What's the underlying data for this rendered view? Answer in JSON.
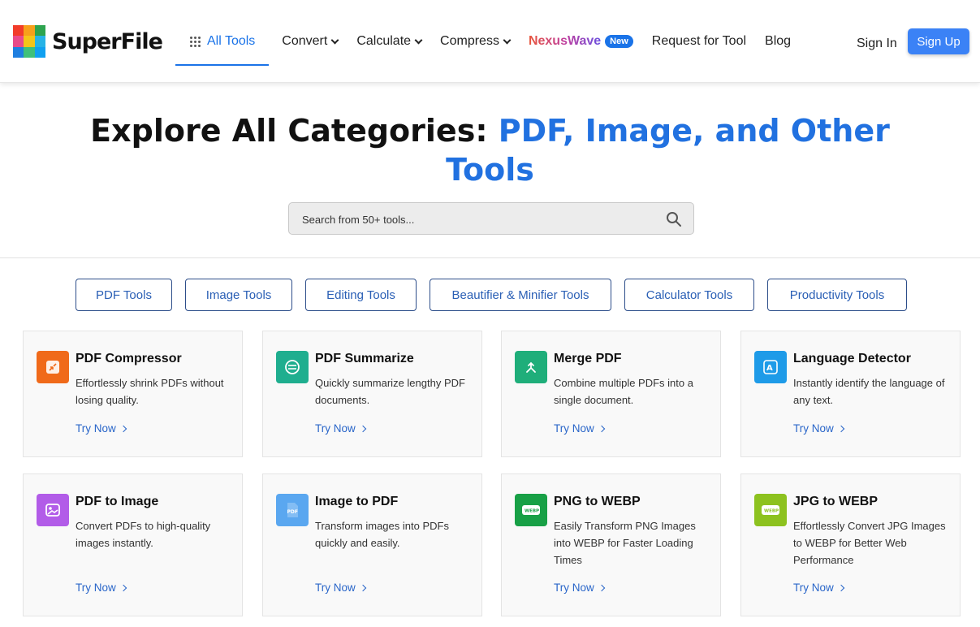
{
  "brand": {
    "name": "SuperFile",
    "logo_colors": [
      "#f23c2a",
      "#f7a01b",
      "#2ea44f",
      "#e94b8a",
      "#f5c518",
      "#27b3e6",
      "#1f7fe0",
      "#3fc07a",
      "#10a0f0"
    ]
  },
  "nav": {
    "all_tools": "All Tools",
    "convert": "Convert",
    "calculate": "Calculate",
    "compress": "Compress",
    "nexuswave": "NexusWave",
    "new_badge": "New",
    "request": "Request for Tool",
    "blog": "Blog",
    "sign_in": "Sign In",
    "sign_up": "Sign Up"
  },
  "hero": {
    "title_plain": "Explore All Categories: ",
    "title_highlight_1": "PDF, Image, and Other",
    "title_highlight_2": "Tools",
    "search_placeholder": "Search from 50+ tools..."
  },
  "categories": [
    "PDF Tools",
    "Image Tools",
    "Editing Tools",
    "Beautifier & Minifier Tools",
    "Calculator Tools",
    "Productivity Tools"
  ],
  "cards": [
    {
      "title": "PDF Compressor",
      "desc": "Effortlessly shrink PDFs without losing quality.",
      "try": "Try Now",
      "icon": "compress-icon",
      "color": "#f06a1a"
    },
    {
      "title": "PDF Summarize",
      "desc": "Quickly summarize lengthy PDF documents.",
      "try": "Try Now",
      "icon": "summarize-icon",
      "color": "#1fae8f"
    },
    {
      "title": "Merge PDF",
      "desc": "Combine multiple PDFs into a single document.",
      "try": "Try Now",
      "icon": "merge-icon",
      "color": "#1fae7a"
    },
    {
      "title": "Language Detector",
      "desc": "Instantly identify the language of any text.",
      "try": "Try Now",
      "icon": "translate-icon",
      "color": "#1e9be8"
    },
    {
      "title": "PDF to Image",
      "desc": "Convert PDFs to high-quality images instantly.",
      "try": "Try Now",
      "icon": "image-icon",
      "color": "#b25ce8"
    },
    {
      "title": "Image to PDF",
      "desc": "Transform images into PDFs quickly and easily.",
      "try": "Try Now",
      "icon": "pdf-file-icon",
      "color": "#5aa7f0"
    },
    {
      "title": "PNG to WEBP",
      "desc": "Easily Transform PNG Images into WEBP for Faster Loading Times",
      "try": "Try Now",
      "icon": "webp-icon",
      "color": "#18a046"
    },
    {
      "title": "JPG to WEBP",
      "desc": "Effortlessly Convert JPG Images to WEBP for Better Web Performance",
      "try": "Try Now",
      "icon": "webp-icon",
      "color": "#8dc21f"
    }
  ]
}
